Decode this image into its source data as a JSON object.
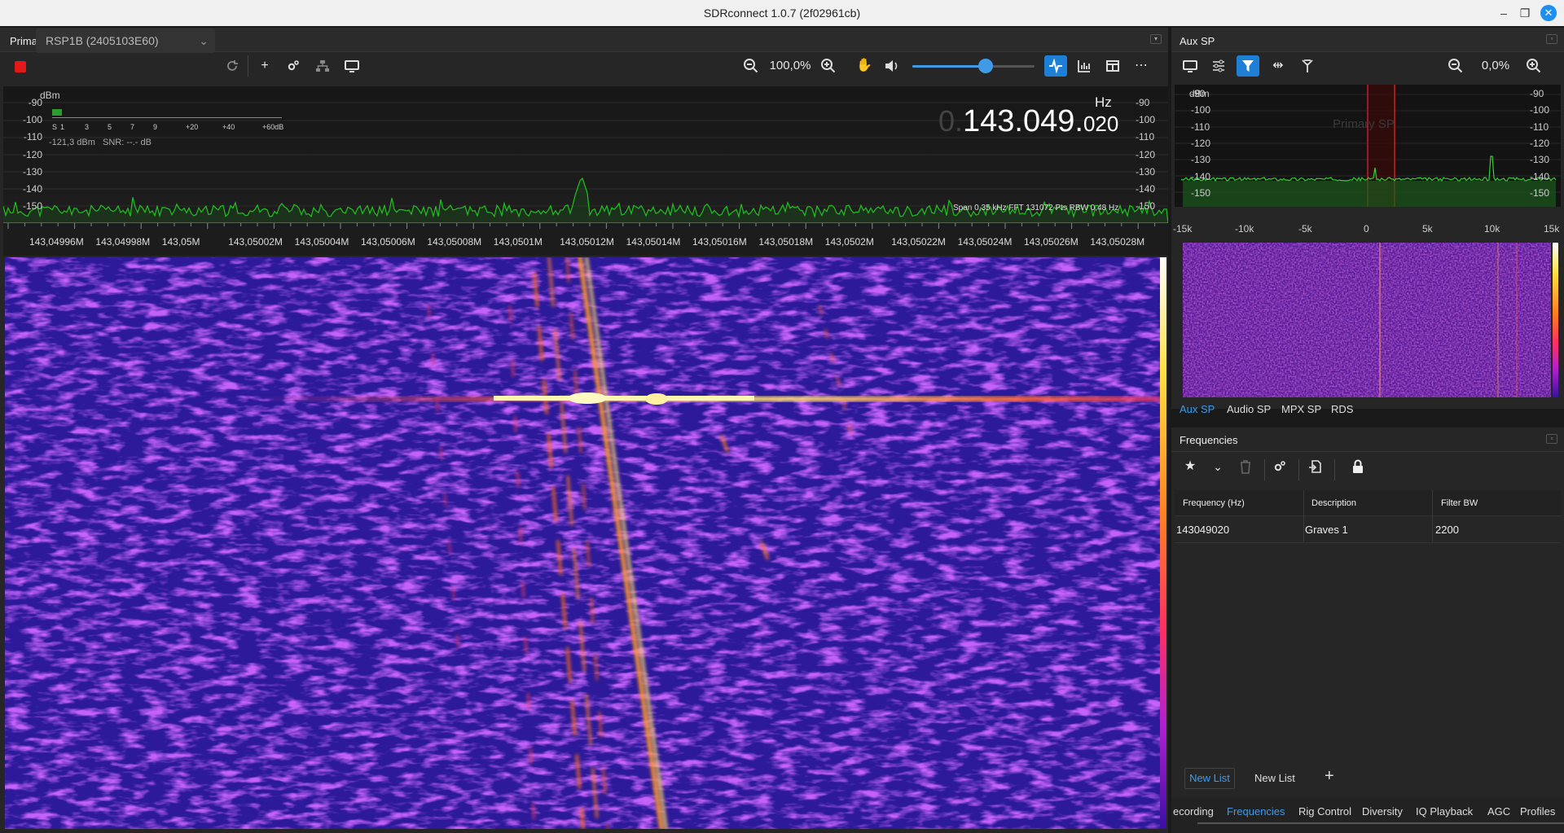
{
  "window": {
    "title": "SDRconnect 1.0.7 (2f02961cb)"
  },
  "primary": {
    "title": "Primary SP",
    "device": "RSP1B (2405103E60)",
    "zoom": "100,0%",
    "volume_fraction": 0.6,
    "dbm_label": "dBm",
    "hz_label": "Hz",
    "freq_dim": "0.",
    "freq_main": "143.049.",
    "freq_small": "020",
    "meter_scale": [
      "S",
      "1",
      "3",
      "5",
      "7",
      "9",
      "+20",
      "+40",
      "+60dB"
    ],
    "level_text": "-121,3 dBm",
    "snr_text": "SNR:  --.- dB",
    "y_ticks": [
      "-90",
      "-100",
      "-110",
      "-120",
      "-130",
      "-140",
      "-150"
    ],
    "info_text": "Span 0,35 kHz  FFT 131072 Pts  RBW 0,48 Hz",
    "freq_ticks": [
      "143,04996M",
      "143,04998M",
      "143,05M",
      "143,05002M",
      "143,05004M",
      "143,05006M",
      "143,05008M",
      "143,0501M",
      "143,05012M",
      "143,05014M",
      "143,05016M",
      "143,05018M",
      "143,0502M",
      "143,05022M",
      "143,05024M",
      "143,05026M",
      "143,05028M"
    ]
  },
  "aux": {
    "title": "Aux SP",
    "zoom": "0,0%",
    "dbm_label": "dBm",
    "y_ticks": [
      "-90",
      "-100",
      "-110",
      "-120",
      "-130",
      "-140",
      "-150"
    ],
    "watermark": "Primary SP",
    "x_ticks": [
      "-15k",
      "-10k",
      "-5k",
      "0",
      "5k",
      "10k",
      "15k"
    ],
    "tabs": [
      {
        "label": "Aux SP",
        "active": true
      },
      {
        "label": "Audio SP",
        "active": false
      },
      {
        "label": "MPX SP",
        "active": false
      },
      {
        "label": "RDS",
        "active": false
      }
    ]
  },
  "frequencies": {
    "title": "Frequencies",
    "columns": [
      "Frequency (Hz)",
      "Description",
      "Filter BW"
    ],
    "rows": [
      {
        "frequency": "143049020",
        "description": "Graves 1",
        "filter_bw": "2200"
      }
    ],
    "lists": [
      "New List",
      "New List"
    ],
    "add_label": "+"
  },
  "bottom_tabs": [
    {
      "label": "ecording",
      "active": false
    },
    {
      "label": "Frequencies",
      "active": true
    },
    {
      "label": "Rig Control",
      "active": false
    },
    {
      "label": "Diversity",
      "active": false
    },
    {
      "label": "IQ Playback",
      "active": false
    },
    {
      "label": "AGC",
      "active": false
    },
    {
      "label": "Profiles",
      "active": false
    }
  ],
  "colors": {
    "accent": "#1e7fd6",
    "stop": "#e0191b",
    "spectrum": "#22c022"
  },
  "icons": [
    "stop-icon",
    "refresh-icon",
    "plus-icon",
    "settings-icon",
    "network-icon",
    "monitor-icon",
    "zoom-out-icon",
    "zoom-in-icon",
    "hand-icon",
    "speaker-icon",
    "waveform-icon",
    "bar-chart-icon",
    "layout-icon",
    "more-icon",
    "sliders-icon",
    "filter-icon",
    "width-icon",
    "antenna-icon",
    "star-icon",
    "trash-icon",
    "import-icon",
    "lock-icon"
  ]
}
